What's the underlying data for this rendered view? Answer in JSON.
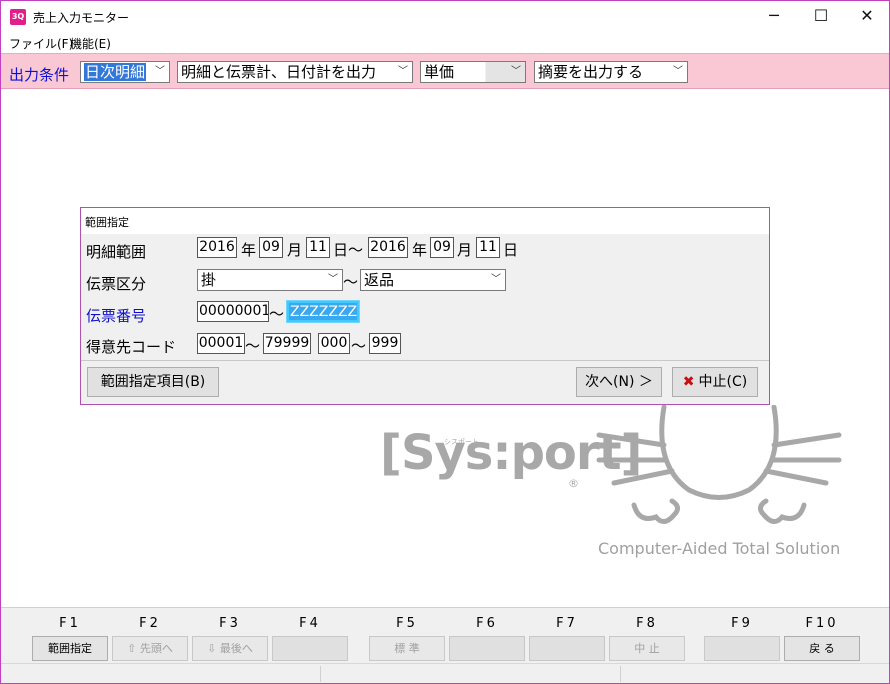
{
  "window": {
    "icon_text": "3Q",
    "title": "売上入力モニター",
    "minimize": "─",
    "maximize": "☐",
    "close": "✕"
  },
  "menu": [
    {
      "label": "ファイル(F)"
    },
    {
      "label": "機能(E)"
    }
  ],
  "conditions": {
    "label": "出力条件",
    "combos": [
      {
        "value": "日次明細"
      },
      {
        "value": "明細と伝票計、日付計を出力"
      },
      {
        "value": "単価"
      },
      {
        "value": "摘要を出力する"
      }
    ]
  },
  "dialog": {
    "title": "範囲指定",
    "detail_range": {
      "label": "明細範囲",
      "from_year": "2016",
      "from_month": "09",
      "from_day": "11",
      "to_year": "2016",
      "to_month": "09",
      "to_day": "11",
      "year_unit": "年",
      "month_unit": "月",
      "day_unit": "日",
      "tilde": "～"
    },
    "slip_type": {
      "label": "伝票区分",
      "from": "掛",
      "to": "返品",
      "tilde": "～"
    },
    "slip_number": {
      "label": "伝票番号",
      "from": "00000001",
      "to": "ZZZZZZZZ",
      "tilde": "～"
    },
    "customer_code": {
      "label": "得意先コード",
      "from": "00001",
      "to": "79999",
      "sub_from": "000",
      "sub_to": "999",
      "tilde": "～"
    },
    "range_items_button": "範囲指定項目(B)",
    "next_button": "次へ(N) ＞",
    "cancel_button": "中止(C)",
    "cancel_icon": "✖"
  },
  "logo": {
    "brand": "[Sys:port]",
    "kana": "シスポート",
    "registered": "®",
    "tagline": "Computer-Aided Total Solution"
  },
  "fkeys": [
    {
      "key": "F1",
      "label": "範囲指定",
      "state": "enabled"
    },
    {
      "key": "F2",
      "label": "⇧ 先頭へ",
      "state": "disabled"
    },
    {
      "key": "F3",
      "label": "⇩ 最後へ",
      "state": "disabled"
    },
    {
      "key": "F4",
      "label": "",
      "state": "empty"
    },
    {
      "key": "F5",
      "label": "標 準",
      "state": "disabled"
    },
    {
      "key": "F6",
      "label": "",
      "state": "empty"
    },
    {
      "key": "F7",
      "label": "",
      "state": "empty"
    },
    {
      "key": "F8",
      "label": "中 止",
      "state": "disabled"
    },
    {
      "key": "F9",
      "label": "",
      "state": "empty"
    },
    {
      "key": "F10",
      "label": "戻 る",
      "state": "enabled"
    }
  ]
}
